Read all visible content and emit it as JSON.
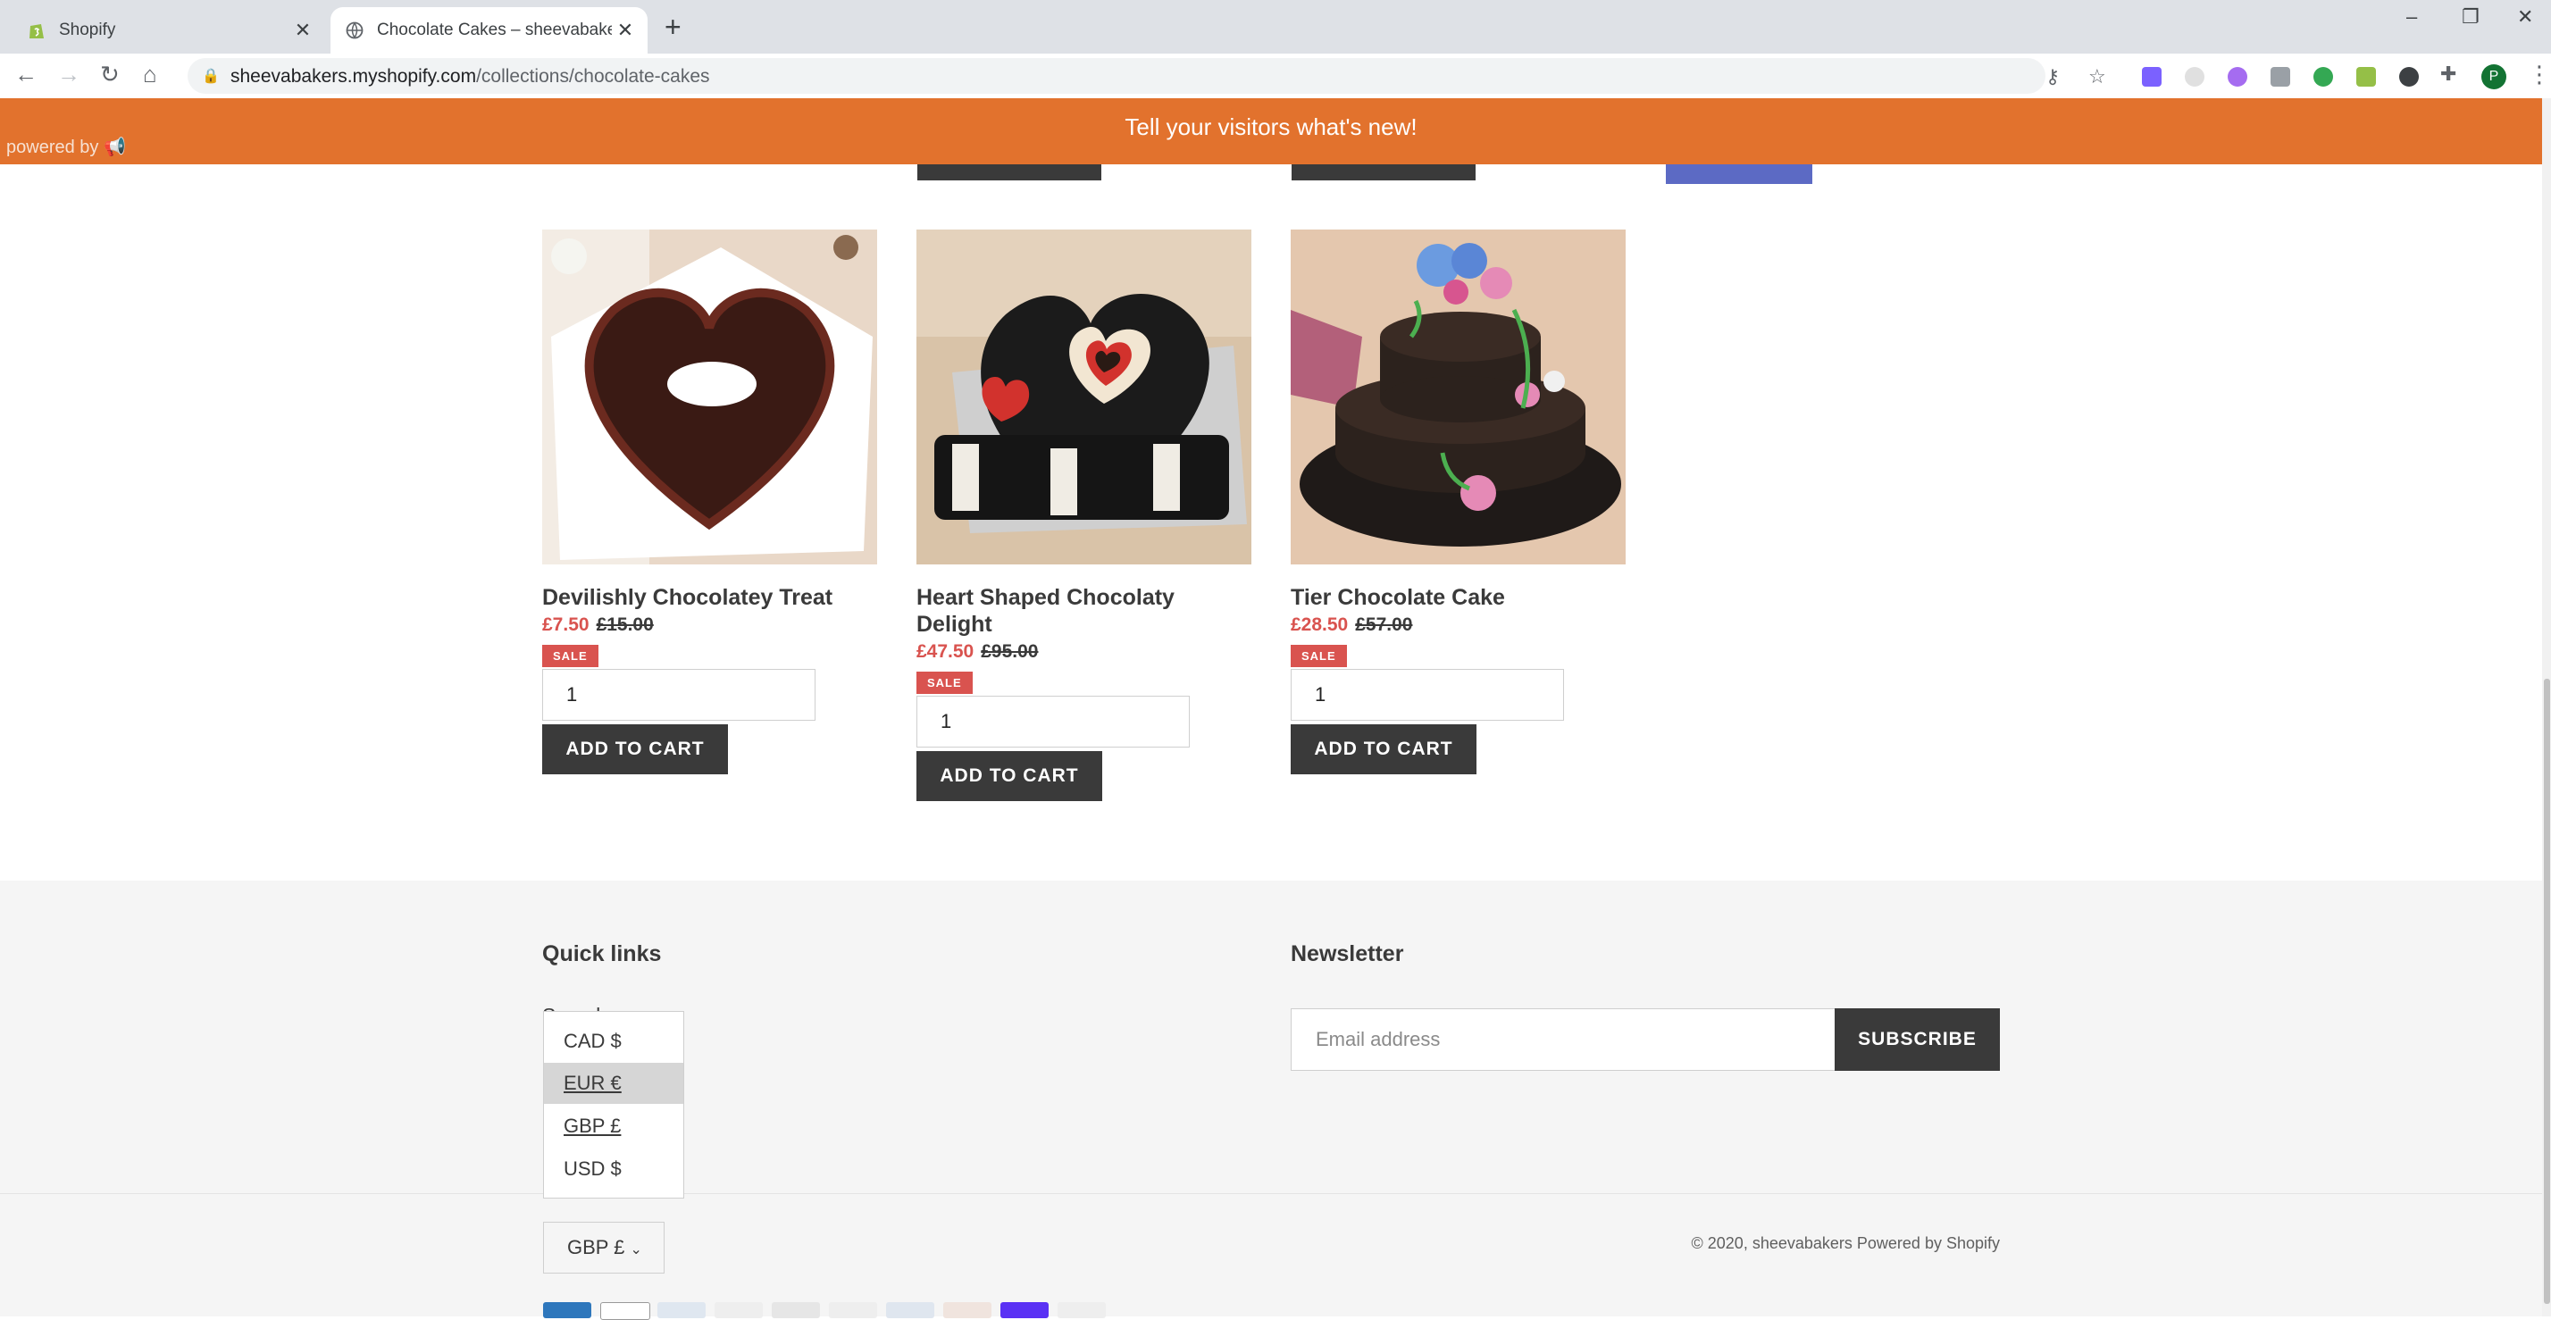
{
  "browser": {
    "tabs": [
      {
        "title": "Shopify",
        "active": false
      },
      {
        "title": "Chocolate Cakes – sheevabakers",
        "active": true
      }
    ],
    "url_host": "sheevabakers.myshopify.com",
    "url_path": "/collections/chocolate-cakes",
    "profile_initial": "P"
  },
  "announcement": {
    "message": "Tell your visitors what's new!",
    "powered_by": "powered by"
  },
  "products": [
    {
      "title": "Devilishly Chocolatey Treat",
      "sale_price": "£7.50",
      "regular_price": "£15.00",
      "badge": "SALE",
      "quantity": "1",
      "button": "ADD TO CART"
    },
    {
      "title": "Heart Shaped Chocolaty Delight",
      "sale_price": "£47.50",
      "regular_price": "£95.00",
      "badge": "SALE",
      "quantity": "1",
      "button": "ADD TO CART"
    },
    {
      "title": "Tier Chocolate Cake",
      "sale_price": "£28.50",
      "regular_price": "£57.00",
      "badge": "SALE",
      "quantity": "1",
      "button": "ADD TO CART"
    }
  ],
  "footer": {
    "quick_links_title": "Quick links",
    "search_link": "Search",
    "newsletter_title": "Newsletter",
    "email_placeholder": "Email address",
    "subscribe_label": "SUBSCRIBE",
    "currency_options": [
      "CAD $",
      "EUR €",
      "GBP £",
      "USD $"
    ],
    "currency_hovered": "EUR €",
    "currency_selected": "GBP £",
    "copyright": "© 2020, sheevabakers Powered by Shopify"
  },
  "colors": {
    "announcement_bg": "#e2722d",
    "sale_red": "#d9534f",
    "button_dark": "#3a3a3a"
  }
}
